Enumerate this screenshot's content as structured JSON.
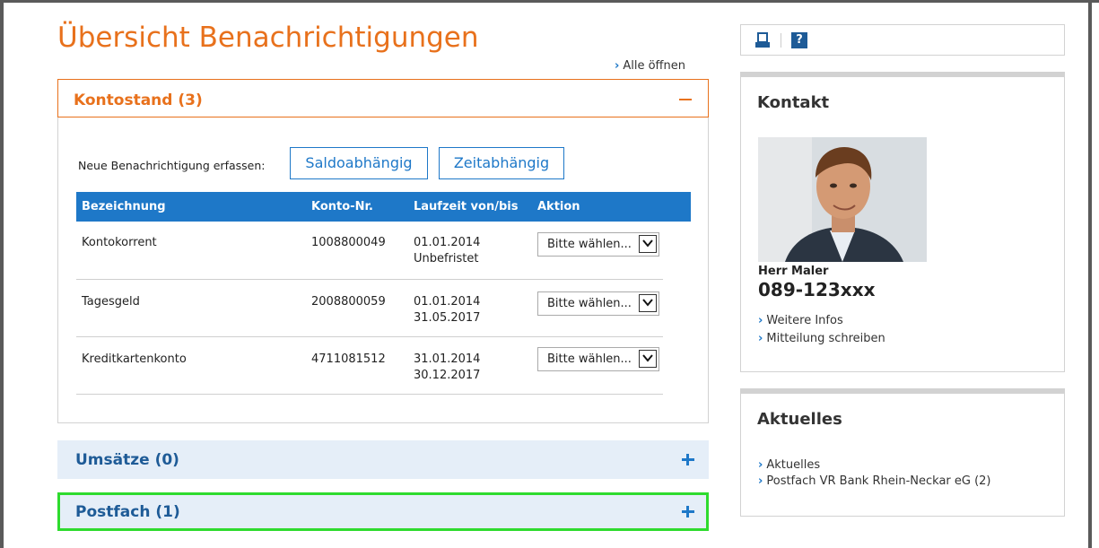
{
  "page": {
    "title": "Übersicht Benachrichtigungen",
    "all_open": "Alle öffnen"
  },
  "kontostand": {
    "title": "Kontostand (3)",
    "new_label": "Neue Benachrichtigung erfassen:",
    "btn_saldo": "Saldoabhängig",
    "btn_zeit": "Zeitabhängig",
    "columns": [
      "Bezeichnung",
      "Konto-Nr.",
      "Laufzeit von/bis",
      "Aktion"
    ],
    "rows": [
      {
        "name": "Kontokorrent",
        "konto": "1008800049",
        "from": "01.01.2014",
        "to": "Unbefristet",
        "action": "Bitte wählen..."
      },
      {
        "name": "Tagesgeld",
        "konto": "2008800059",
        "from": "01.01.2014",
        "to": "31.05.2017",
        "action": "Bitte wählen..."
      },
      {
        "name": "Kreditkartenkonto",
        "konto": "4711081512",
        "from": "31.01.2014",
        "to": "30.12.2017",
        "action": "Bitte wählen..."
      }
    ]
  },
  "umsaetze": {
    "title": "Umsätze (0)"
  },
  "postfach": {
    "title": "Postfach (1)"
  },
  "kontakt": {
    "title": "Kontakt",
    "name": "Herr Maler",
    "phone": "089-123xxx",
    "links": [
      "Weitere Infos",
      "Mitteilung schreiben"
    ]
  },
  "aktuelles": {
    "title": "Aktuelles",
    "links": [
      "Aktuelles",
      "Postfach VR Bank Rhein-Neckar eG (2)"
    ]
  },
  "colors": {
    "accent": "#e8711c",
    "blue": "#1e78c8",
    "highlight": "#2edb2e"
  }
}
